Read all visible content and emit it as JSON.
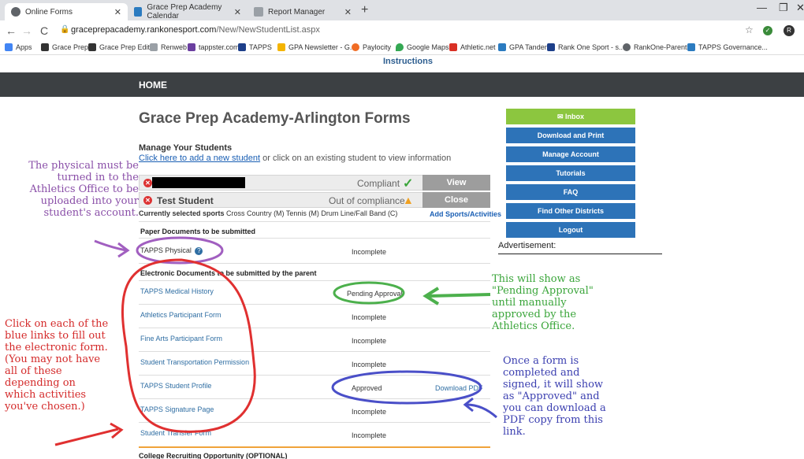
{
  "browser": {
    "tabs": [
      {
        "title": "Online Forms",
        "active": true
      },
      {
        "title": "Grace Prep Academy Calendar",
        "active": false
      },
      {
        "title": "Report Manager",
        "active": false
      }
    ],
    "url_host": "graceprepacademy.rankonesport.com",
    "url_path": "/New/NewStudentList.aspx",
    "bookmarks": [
      "Apps",
      "Grace Prep",
      "Grace Prep Edit",
      "Renweb",
      "tappster.com",
      "TAPPS",
      "GPA Newsletter - G...",
      "Paylocity",
      "Google Maps",
      "Athletic.net",
      "GPA Tandem",
      "Rank One Sport - s...",
      "RankOne-Parents",
      "TAPPS Governance..."
    ],
    "profile_initial": "R"
  },
  "page": {
    "instructions_link": "Instructions",
    "nav_home": "HOME",
    "title": "Grace Prep Academy-Arlington Forms",
    "manage_heading": "Manage Your Students",
    "add_link": "Click here to add a new student",
    "add_suffix": " or click on an existing student to view information",
    "students": [
      {
        "name": "",
        "status": "Compliant",
        "button": "View"
      },
      {
        "name": "Test Student",
        "status": "Out of compliance",
        "button": "Close"
      }
    ],
    "sports_label": "Currently selected sports",
    "sports_value": " Cross Country (M) Tennis (M) Drum Line/Fall Band (C)",
    "add_sports": "Add Sports/Activities",
    "paper_heading": "Paper Documents to be submitted",
    "paper_docs": [
      {
        "label": "TAPPS Physical",
        "status": "Incomplete"
      }
    ],
    "electronic_heading": "Electronic Documents to be submitted by the parent",
    "electronic_docs": [
      {
        "label": "TAPPS Medical History",
        "status": "Pending Approval",
        "download": ""
      },
      {
        "label": "Athletics Participant Form",
        "status": "Incomplete",
        "download": ""
      },
      {
        "label": "Fine Arts Participant Form",
        "status": "Incomplete",
        "download": ""
      },
      {
        "label": "Student Transportation Permission",
        "status": "Incomplete",
        "download": ""
      },
      {
        "label": "TAPPS Student Profile",
        "status": "Approved",
        "download": "Download PDF"
      },
      {
        "label": "TAPPS Signature Page",
        "status": "Incomplete",
        "download": ""
      },
      {
        "label": "Student Transfer Form",
        "status": "Incomplete",
        "download": ""
      }
    ],
    "college_heading": "College Recruiting Opportunity (OPTIONAL)"
  },
  "sidebar": {
    "buttons": [
      "Inbox",
      "Download and Print",
      "Manage Account",
      "Tutorials",
      "FAQ",
      "Find Other Districts",
      "Logout"
    ],
    "advertisement": "Advertisement:"
  },
  "annotations": {
    "purple": "The physical must be turned in to the Athletics Office to be uploaded into your student's account.",
    "red": "Click on each of the blue links to fill out the electronic form. (You may not have all of these depending on which activities you've chosen.)",
    "green": "This will show as \"Pending Approval\" until manually approved by the Athletics Office.",
    "blue": "Once a form is completed and signed, it will show as \"Approved\" and you can download a PDF copy from this link."
  },
  "colors": {
    "annotation_purple": "#8a4fa8",
    "annotation_red": "#d42a2a",
    "annotation_green": "#3aa53a",
    "annotation_blue": "#3b3fb0",
    "menu_blue": "#2d73b8",
    "inbox_green": "#8cc63f",
    "navbar": "#3c4043"
  }
}
